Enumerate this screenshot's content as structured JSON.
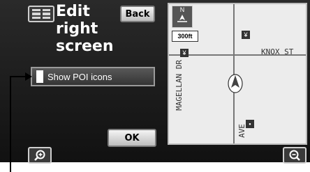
{
  "title": "Edit\nright\nscreen",
  "buttons": {
    "back": "Back",
    "ok": "OK"
  },
  "poi_option": {
    "label": "Show POI icons",
    "checked": true
  },
  "map": {
    "scale": "300ft",
    "north_label": "N",
    "streets": {
      "east_west": "KNOX ST",
      "north_south": "MAGELLAN DR",
      "lower": "AVE"
    }
  },
  "colors": {
    "screen_bg": "#1e1e1e",
    "map_bg": "#ececec",
    "button_face": "#d9d9d9"
  },
  "icons": [
    "list-icon",
    "zoom-in-icon",
    "zoom-out-icon",
    "poi-icon",
    "vehicle-position-icon"
  ]
}
